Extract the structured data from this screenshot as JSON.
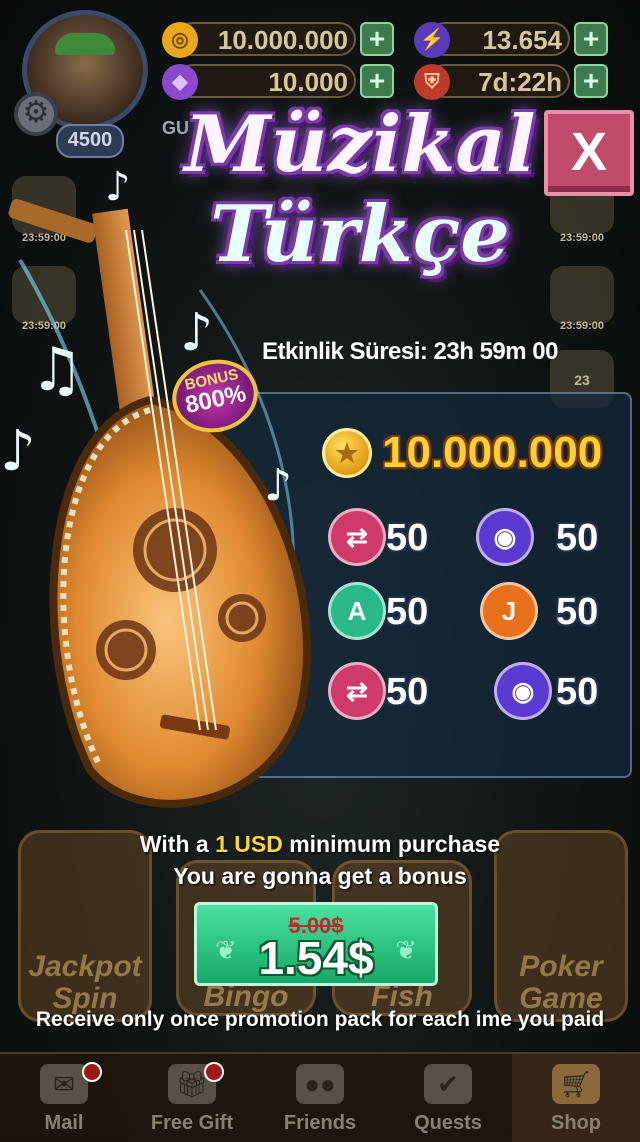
{
  "header": {
    "level": "4500",
    "coins": "10.000.000",
    "energy": "13.654",
    "gems": "10.000",
    "shield_timer": "7d:22h",
    "partial_label": "GU",
    "side_timer": "23:59:00",
    "side_badge": "23"
  },
  "popup": {
    "title_line1": "Müzikal",
    "title_line2": "Türkçe",
    "close_label": "X",
    "duration": "Etkinlik Süresi: 23h 59m 00",
    "bonus_badge_top": "BONUS",
    "bonus_badge_value": "800%",
    "coin_reward": "10.000.000",
    "items": [
      {
        "icon": "swap-cards-icon",
        "qty": "50",
        "color": "#d03a6a"
      },
      {
        "icon": "eye-icon",
        "qty": "50",
        "color": "#5a3ad0"
      },
      {
        "icon": "auto-spin-icon",
        "qty": "50",
        "color": "#2ab88a"
      },
      {
        "icon": "jackpot-percent-icon",
        "qty": "50",
        "color": "#e8701a"
      },
      {
        "icon": "swap-cards-icon",
        "qty": "50",
        "color": "#d03a6a"
      },
      {
        "icon": "eye-gear-icon",
        "qty": "50",
        "color": "#5a3ad0"
      }
    ],
    "purchase_line1_pre": "With a ",
    "purchase_line1_highlight": "1 USD",
    "purchase_line1_post": " minimum purchase",
    "purchase_line2": "You are gonna get a bonus",
    "old_price": "5.00$",
    "new_price": "1.54$",
    "note": "Receive only once promotion pack for each ime you paid"
  },
  "background_tiles": [
    {
      "label": "Jackpot Spin"
    },
    {
      "label": "Bingo"
    },
    {
      "label": "Fish"
    },
    {
      "label": "Poker Game"
    }
  ],
  "bottom_nav": [
    {
      "label": "Mail",
      "icon": "mail-icon",
      "dot": true
    },
    {
      "label": "Free Gift",
      "icon": "gift-icon",
      "dot": true
    },
    {
      "label": "Friends",
      "icon": "friends-icon",
      "dot": false
    },
    {
      "label": "Quests",
      "icon": "quests-icon",
      "dot": false
    },
    {
      "label": "Shop",
      "icon": "shop-cart-icon",
      "dot": false
    }
  ],
  "colors": {
    "title_outline": "#7a3aa8",
    "coin_text": "#ffd030",
    "highlight": "#ffd830",
    "buy_button": "#16a868",
    "close_button": "#c04a6a"
  }
}
